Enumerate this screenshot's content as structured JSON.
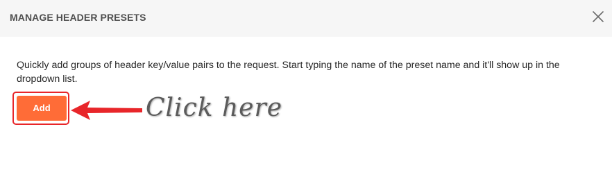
{
  "dialog": {
    "title": "MANAGE HEADER PRESETS",
    "close_icon": "close-icon",
    "description": "Quickly add groups of header key/value pairs to the request. Start typing the name of the preset name and it'll show up in the dropdown list.",
    "add_button_label": "Add"
  },
  "annotation": {
    "callout_text": "Click here",
    "arrow_icon": "arrow-left-icon",
    "highlight_color": "#e8262a"
  },
  "colors": {
    "header_bg": "#f6f6f6",
    "accent": "#ff6c37",
    "text": "#282828",
    "title_text": "#505050"
  }
}
